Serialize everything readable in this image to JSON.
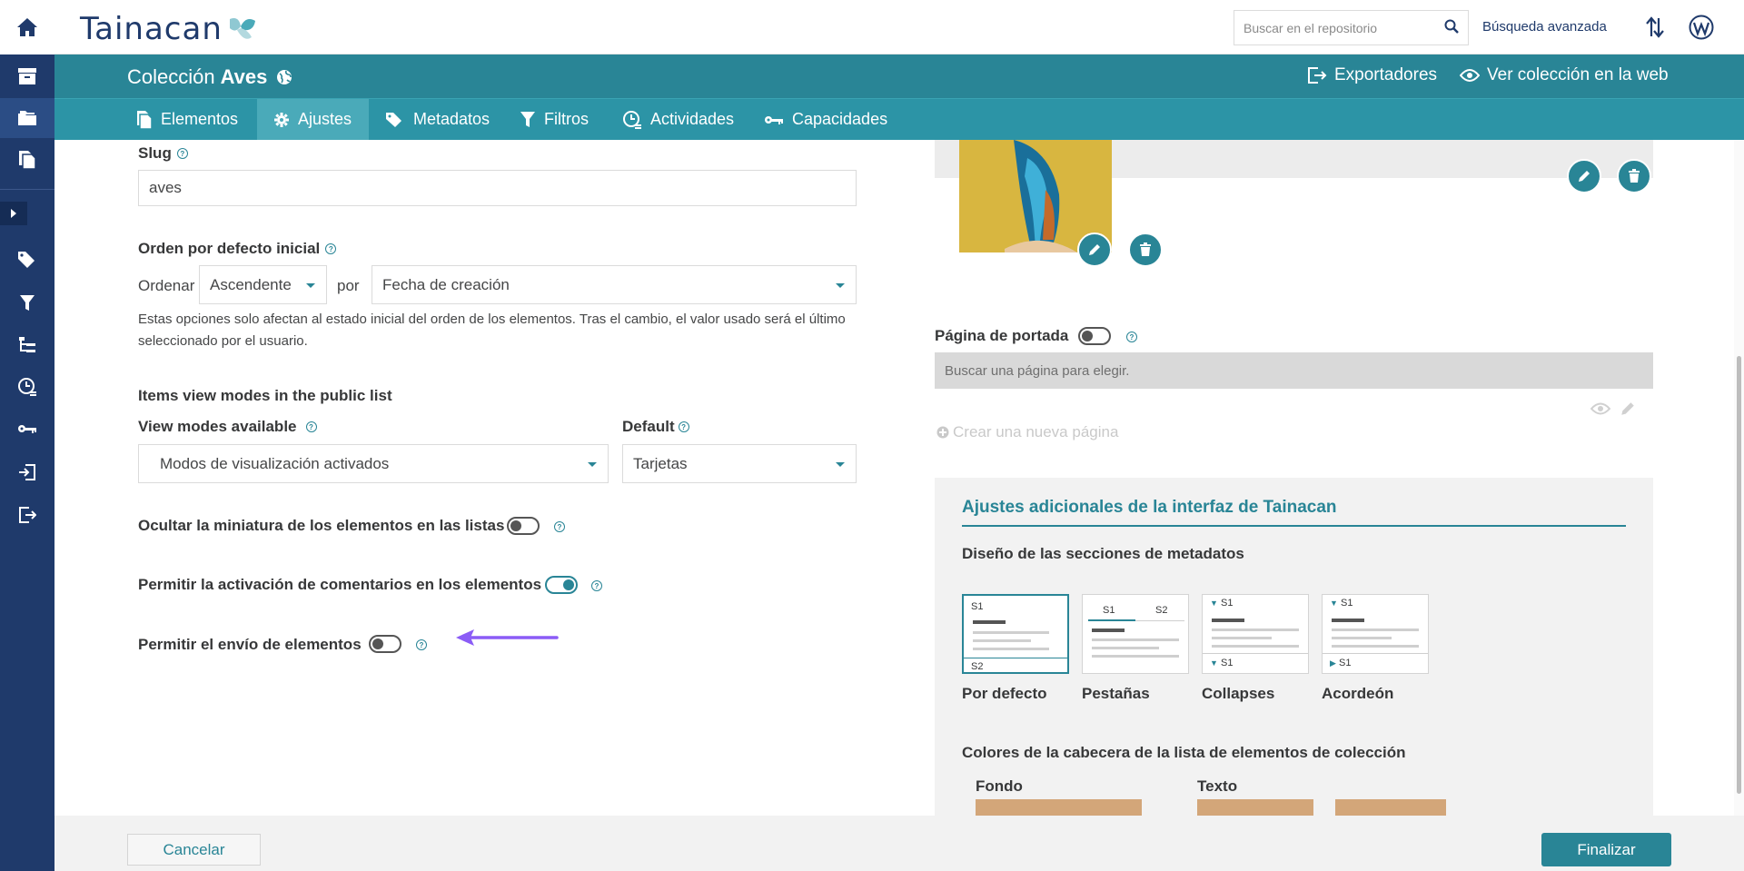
{
  "top": {
    "logo_text": "Tainacan",
    "search_placeholder": "Buscar en el repositorio",
    "advanced_search": "Búsqueda avanzada"
  },
  "collection": {
    "prefix": "Colección",
    "name": "Aves",
    "exporters": "Exportadores",
    "view_web": "Ver colección en la web"
  },
  "tabs": [
    {
      "label": "Elementos",
      "icon": "items-icon"
    },
    {
      "label": "Ajustes",
      "icon": "gear-icon",
      "active": true
    },
    {
      "label": "Metadatos",
      "icon": "tags-icon"
    },
    {
      "label": "Filtros",
      "icon": "filter-icon"
    },
    {
      "label": "Actividades",
      "icon": "activities-icon"
    },
    {
      "label": "Capacidades",
      "icon": "key-icon"
    }
  ],
  "form": {
    "slug_label": "Slug",
    "slug_value": "aves",
    "order_label": "Orden por defecto inicial",
    "order_prefix": "Ordenar",
    "order_value": "Ascendente",
    "order_by": "por",
    "order_by_value": "Fecha de creación",
    "order_desc": "Estas opciones solo afectan al estado inicial del orden de los elementos. Tras el cambio, el valor usado será el último seleccionado por el usuario.",
    "view_modes_heading": "Items view modes in the public list",
    "view_modes_label": "View modes available",
    "view_modes_value": "Modos de visualización activados",
    "default_label": "Default",
    "default_value": "Tarjetas",
    "hide_thumb_label": "Ocultar la miniatura de los elementos en las listas",
    "hide_thumb_on": false,
    "comments_label": "Permitir la activación de comentarios en los elementos",
    "comments_on": true,
    "submission_label": "Permitir el envío de elementos",
    "submission_on": false
  },
  "right": {
    "cover_page_label": "Página de portada",
    "cover_page_on": false,
    "cover_page_placeholder": "Buscar una página para elegir.",
    "new_page": "Crear una nueva página",
    "panel_title": "Ajustes adicionales de la interfaz de Tainacan",
    "layout_heading": "Diseño de las secciones de metadatos",
    "layouts": [
      {
        "name": "Por defecto",
        "selected": true
      },
      {
        "name": "Pestañas",
        "selected": false
      },
      {
        "name": "Collapses",
        "selected": false
      },
      {
        "name": "Acordeón",
        "selected": false
      }
    ],
    "layout_s1": "S1",
    "layout_s2": "S2",
    "colors_heading": "Colores de la cabecera de la lista de elementos de colección",
    "bg_label": "Fondo",
    "text_label": "Texto",
    "swatch_color": "#d3a679"
  },
  "footer": {
    "cancel": "Cancelar",
    "finish": "Finalizar"
  },
  "colors": {
    "sidebar": "#1f3a6b",
    "accent": "#298596",
    "arrow": "#8b5cf6"
  }
}
